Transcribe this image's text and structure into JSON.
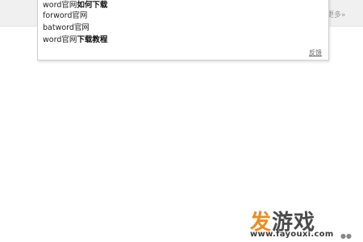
{
  "header": {
    "more_label": "更多»"
  },
  "suggestions": {
    "items": [
      {
        "normal": "word官网",
        "bold": "如何下载"
      },
      {
        "normal": "forword官网",
        "bold": ""
      },
      {
        "normal": "batword官网",
        "bold": ""
      },
      {
        "normal": "word官网",
        "bold": "下载教程"
      }
    ],
    "feedback_label": "反馈"
  },
  "watermark": {
    "logo_part1": "发",
    "logo_part2": "游戏",
    "url": "www.fayouxi.com",
    "colors": {
      "accent": "#f08a24",
      "dark": "#4a4a4a"
    }
  }
}
